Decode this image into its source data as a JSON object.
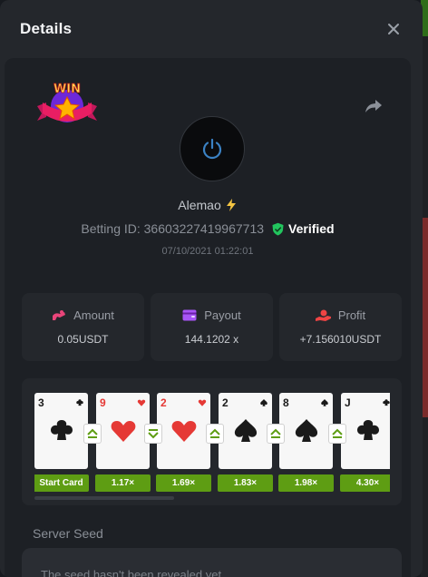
{
  "modal": {
    "title": "Details",
    "close_icon": "close-icon"
  },
  "badge": {
    "text": "WIN"
  },
  "player": {
    "name": "Alemao",
    "betting_id": "Betting ID: 366032274199677​13",
    "verified": "Verified",
    "datetime": "07/10/2021 01:22:01"
  },
  "stats": [
    {
      "label": "Amount",
      "value": "0.05USDT",
      "icon": "coins-icon",
      "color": "#e9457a"
    },
    {
      "label": "Payout",
      "value": "144.1202 x",
      "icon": "wallet-icon",
      "color": "#a855f7"
    },
    {
      "label": "Profit",
      "value": "+7.156010USDT",
      "icon": "hand-coin-icon",
      "color": "#ef4444"
    }
  ],
  "cards": [
    {
      "rank": "3",
      "suit": "clubs",
      "color": "#1a1a1a",
      "multiplier": "Start Card"
    },
    {
      "rank": "9",
      "suit": "hearts",
      "color": "#e53935",
      "arrow": "up",
      "multiplier": "1.17×"
    },
    {
      "rank": "2",
      "suit": "hearts",
      "color": "#e53935",
      "arrow": "down",
      "multiplier": "1.69×"
    },
    {
      "rank": "2",
      "suit": "spades",
      "color": "#1a1a1a",
      "arrow": "up",
      "multiplier": "1.83×"
    },
    {
      "rank": "8",
      "suit": "spades",
      "color": "#1a1a1a",
      "arrow": "up",
      "multiplier": "1.98×"
    },
    {
      "rank": "J",
      "suit": "clubs",
      "color": "#1a1a1a",
      "arrow": "up",
      "multiplier": "4.30×"
    }
  ],
  "server_seed": {
    "title": "Server Seed",
    "text": "The seed hasn't been revealed yet"
  },
  "colors": {
    "accent_green": "#5e9d13",
    "verified_green": "#22c55e",
    "bolt": "#f5c542"
  }
}
